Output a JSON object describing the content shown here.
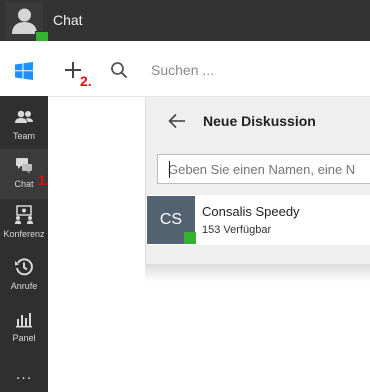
{
  "app": {
    "title": "Chat"
  },
  "toolbar": {
    "search_placeholder": "Suchen ..."
  },
  "annotations": {
    "one": "1.",
    "two": "2."
  },
  "sidebar": {
    "items": [
      {
        "label": "Team",
        "icon": "team-icon"
      },
      {
        "label": "Chat",
        "icon": "chat-icon"
      },
      {
        "label": "Konferenz",
        "icon": "conference-icon"
      },
      {
        "label": "Anrufe",
        "icon": "history-icon"
      },
      {
        "label": "Panel",
        "icon": "panel-icon"
      }
    ],
    "more": "..."
  },
  "panel": {
    "title": "Neue Diskussion",
    "input_placeholder": "Geben Sie einen Namen, eine N",
    "contact": {
      "initials": "CS",
      "name": "Consalis Speedy",
      "status": "153 Verfügbar"
    }
  },
  "colors": {
    "presence": "#35b233",
    "annotation": "#e01010",
    "avatar": "#536270"
  }
}
